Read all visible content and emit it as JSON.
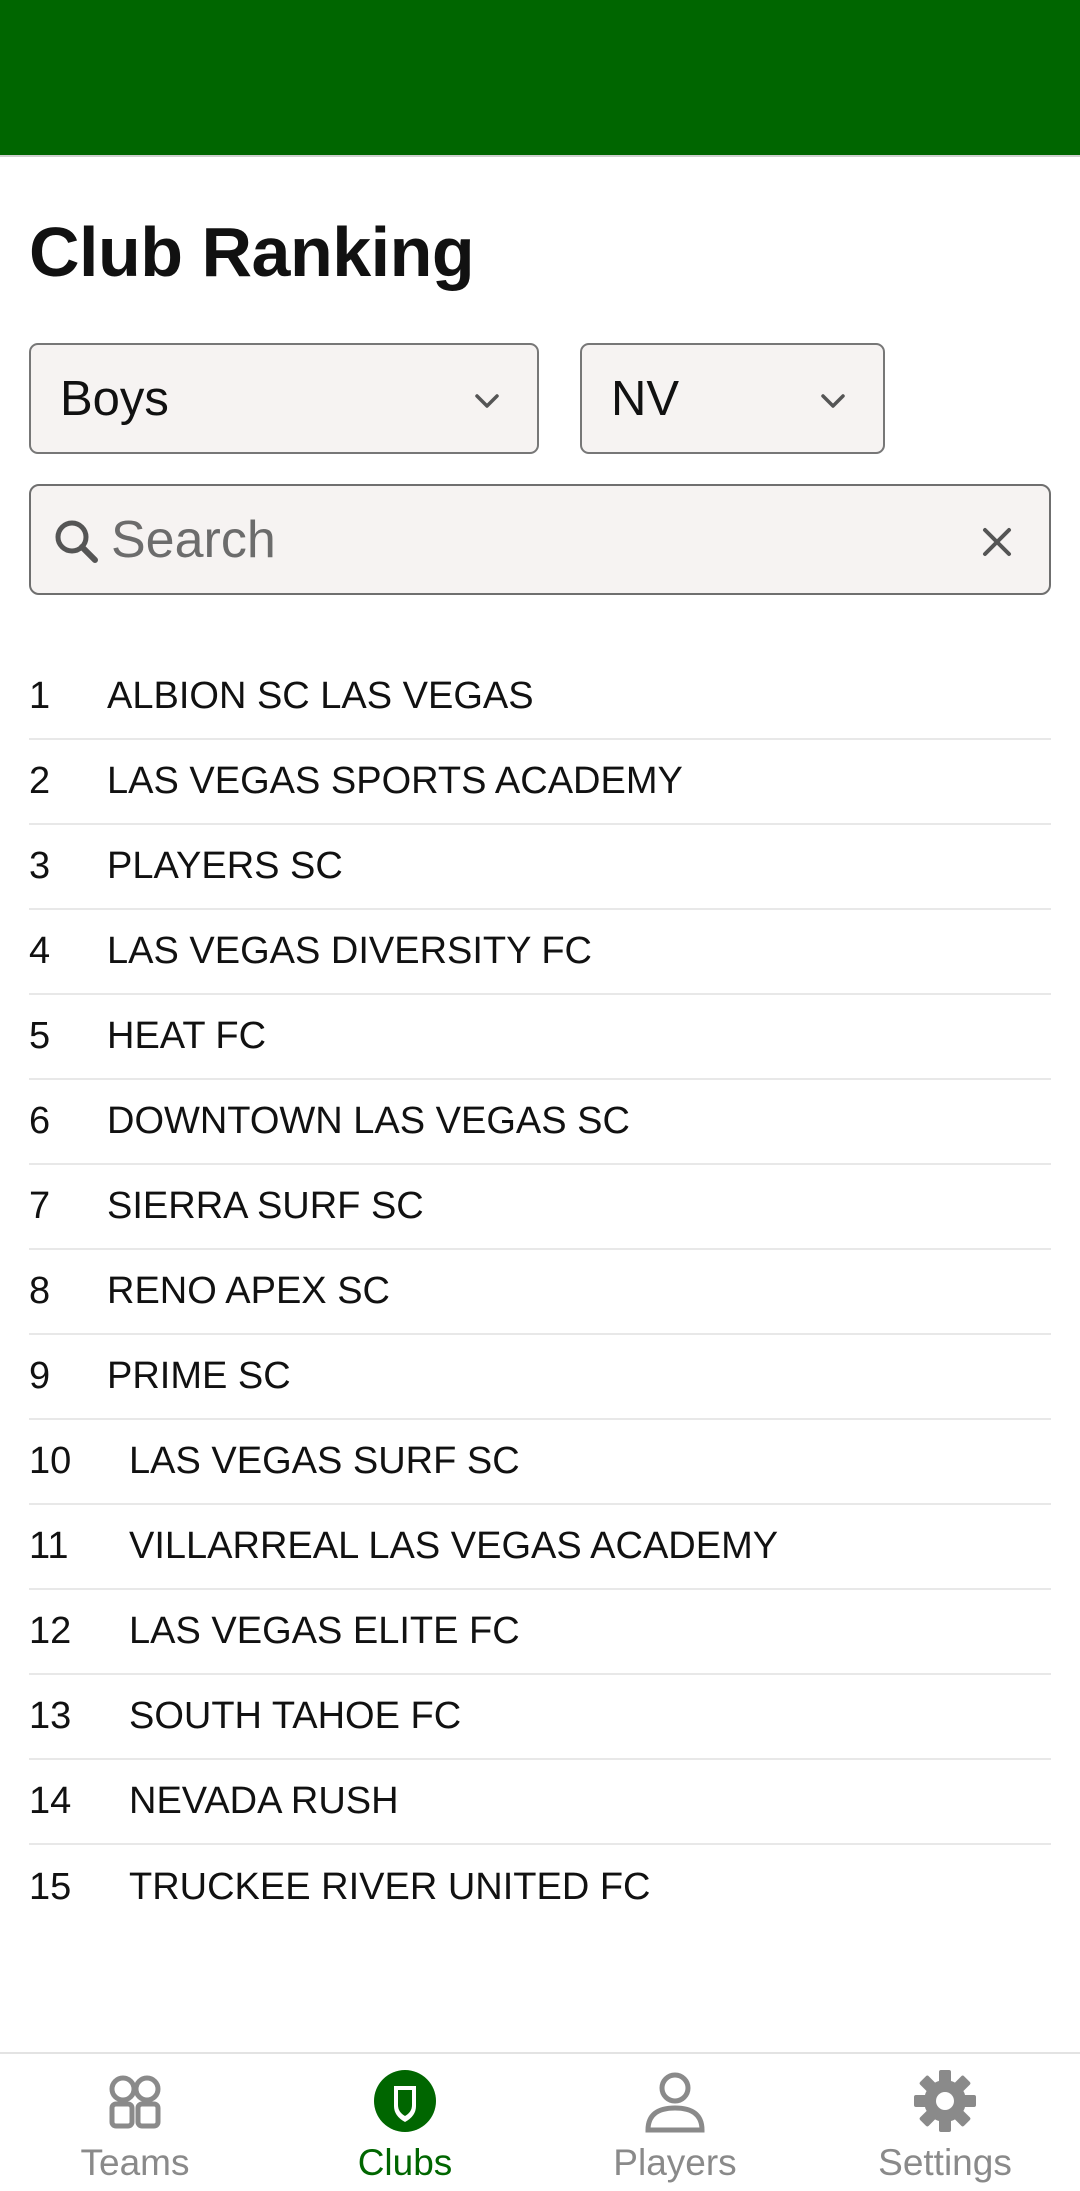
{
  "page": {
    "title": "Club Ranking"
  },
  "filters": {
    "gender": "Boys",
    "state": "NV"
  },
  "search": {
    "placeholder": "Search",
    "value": ""
  },
  "rankings": [
    {
      "rank": "1",
      "club": "ALBION SC LAS VEGAS"
    },
    {
      "rank": "2",
      "club": "LAS VEGAS SPORTS ACADEMY"
    },
    {
      "rank": "3",
      "club": "PLAYERS SC"
    },
    {
      "rank": "4",
      "club": "LAS VEGAS DIVERSITY FC"
    },
    {
      "rank": "5",
      "club": "HEAT FC"
    },
    {
      "rank": "6",
      "club": "DOWNTOWN LAS VEGAS SC"
    },
    {
      "rank": "7",
      "club": "SIERRA SURF SC"
    },
    {
      "rank": "8",
      "club": "RENO APEX SC"
    },
    {
      "rank": "9",
      "club": "PRIME SC"
    },
    {
      "rank": "10",
      "club": "LAS VEGAS SURF SC"
    },
    {
      "rank": "11",
      "club": "VILLARREAL LAS VEGAS ACADEMY"
    },
    {
      "rank": "12",
      "club": "LAS VEGAS ELITE FC"
    },
    {
      "rank": "13",
      "club": "SOUTH TAHOE FC"
    },
    {
      "rank": "14",
      "club": "NEVADA RUSH"
    },
    {
      "rank": "15",
      "club": "TRUCKEE RIVER UNITED FC"
    }
  ],
  "nav": {
    "teams": {
      "label": "Teams",
      "icon": "teams-icon"
    },
    "clubs": {
      "label": "Clubs",
      "icon": "clubs-shield-icon"
    },
    "players": {
      "label": "Players",
      "icon": "player-icon"
    },
    "settings": {
      "label": "Settings",
      "icon": "gear-icon"
    },
    "active": "clubs"
  },
  "colors": {
    "brand_green": "#006600",
    "field_bg": "#f6f3f2",
    "inactive_nav": "#8a8a8a"
  }
}
